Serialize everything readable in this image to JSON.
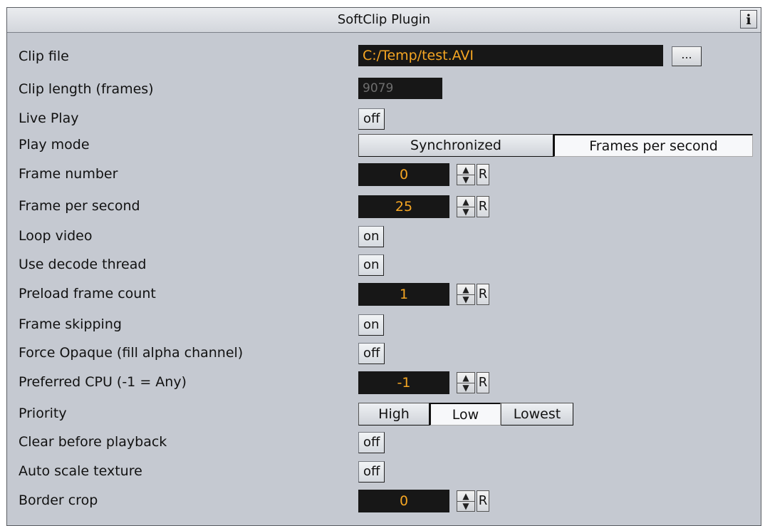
{
  "title": "SoftClip Plugin",
  "info_label": "i",
  "rows": {
    "clip_file": {
      "label": "Clip file",
      "value": "C:/Temp/test.AVI",
      "browse": "..."
    },
    "clip_length": {
      "label": "Clip length (frames)",
      "value": "9079"
    },
    "live_play": {
      "label": "Live Play",
      "value": "off"
    },
    "play_mode": {
      "label": "Play mode",
      "options": [
        "Synchronized",
        "Frames per second"
      ],
      "selected": "Synchronized"
    },
    "frame_number": {
      "label": "Frame number",
      "value": "0",
      "reset": "R"
    },
    "frame_per_second": {
      "label": "Frame per second",
      "value": "25",
      "reset": "R"
    },
    "loop_video": {
      "label": "Loop video",
      "value": "on"
    },
    "use_decode_thread": {
      "label": "Use decode thread",
      "value": "on"
    },
    "preload_frame_count": {
      "label": "Preload frame count",
      "value": "1",
      "reset": "R"
    },
    "frame_skipping": {
      "label": "Frame skipping",
      "value": "on"
    },
    "force_opaque": {
      "label": "Force Opaque (fill alpha channel)",
      "value": "off"
    },
    "preferred_cpu": {
      "label": "Preferred CPU (-1 = Any)",
      "value": "-1",
      "reset": "R"
    },
    "priority": {
      "label": "Priority",
      "options": [
        "High",
        "Low",
        "Lowest"
      ],
      "selected": "High"
    },
    "clear_before_playback": {
      "label": "Clear before playback",
      "value": "off"
    },
    "auto_scale_texture": {
      "label": "Auto scale texture",
      "value": "off"
    },
    "border_crop": {
      "label": "Border crop",
      "value": "0",
      "reset": "R"
    }
  },
  "icons": {
    "spin_up": "arrow-up-icon",
    "spin_down": "arrow-down-icon",
    "info": "info-icon"
  },
  "colors": {
    "panel_bg": "#c5c9d1",
    "field_bg": "#171717",
    "value_text": "#f5a623",
    "disabled_text": "#6e6e6e"
  }
}
